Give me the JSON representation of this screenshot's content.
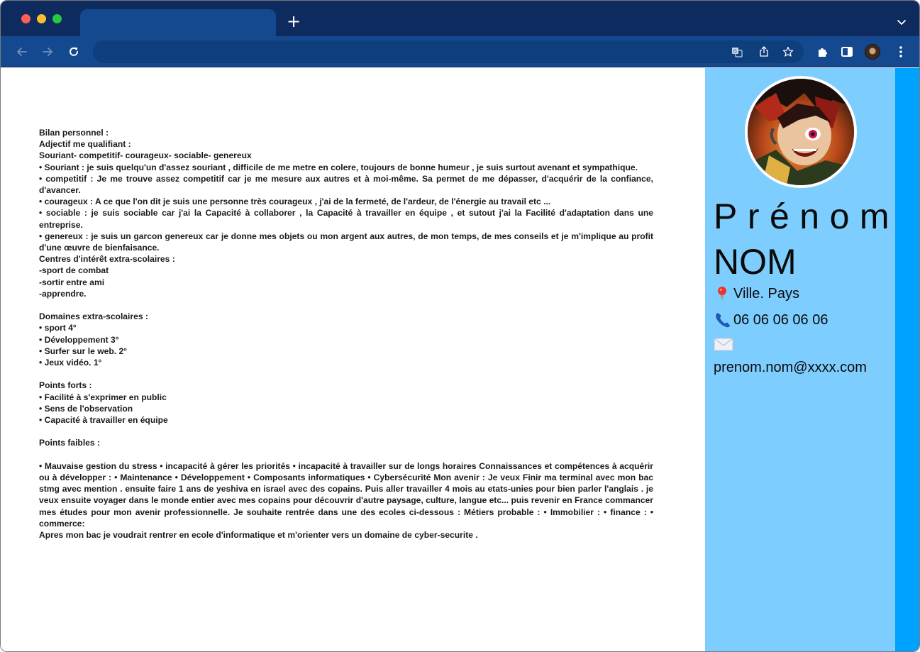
{
  "browser": {
    "new_tab_label": "+",
    "address_value": ""
  },
  "document": {
    "paragraphs": [
      "Bilan personnel :",
      "Adjectif me qualifiant :",
      "Souriant- competitif- courageux- sociable- genereux",
      "• Souriant : je suis quelqu'un d'assez souriant , difficile de me metre en colere, toujours de bonne humeur , je suis surtout avenant et sympathique.",
      "• competitif : Je me trouve assez competitif car je me mesure aux autres et à moi-même. Sa permet de me dépasser, d'acquérir de la confiance, d'avancer.",
      "• courageux : A ce que l'on dit je suis une personne très courageux , j'ai de la fermeté, de l'ardeur, de l'énergie au travail etc ...",
      "• sociable : je suis sociable car j'ai la Capacité à collaborer , la Capacité à travailler en équipe , et sutout j'ai la Facilité d'adaptation dans une entreprise.",
      "• genereux : je suis un garcon genereux car je donne mes objets ou mon argent aux autres, de mon temps, de mes conseils et je m'implique au profit d'une œuvre de bienfaisance.",
      "Centres d'intérêt extra-scolaires :",
      "-sport de combat",
      "-sortir entre ami",
      "-apprendre.",
      "",
      "Domaines extra-scolaires :",
      "• sport 4°",
      "• Développement 3°",
      "• Surfer sur le web. 2°",
      "• Jeux vidéo. 1°",
      "",
      "Points forts :",
      "• Facilité à s'exprimer en public",
      "• Sens de l'observation",
      "• Capacité à travailler en équipe",
      "",
      "Points faibles :",
      "",
      "• Mauvaise gestion du stress • incapacité à gérer les priorités • incapacité à travailler sur de longs horaires Connaissances et compétences à acquérir ou à développer : • Maintenance • Développement • Composants informatiques • Cybersécurité Mon avenir : Je veux Finir ma terminal avec mon bac stmg avec mention . ensuite faire 1 ans de yeshiva en israel avec des copains. Puis aller travailler 4 mois au etats-unies pour bien parler l'anglais . je veux ensuite voyager dans le monde entier avec mes copains pour découvrir d'autre paysage, culture, langue etc... puis revenir en France commancer mes études pour mon avenir professionnelle. Je souhaite rentrée dans une des ecoles ci-dessous : Métiers probable : • Immobilier : • finance : • commerce:",
      "Apres mon bac je voudrait rentrer en ecole d'informatique et m'orienter vers un domaine de cyber-securite ."
    ]
  },
  "sidebar": {
    "first_name": "Prénom",
    "last_name": "NOM",
    "city": "Ville. Pays",
    "phone": "06 06 06 06 06",
    "email": "prenom.nom@xxxx.com",
    "icons": {
      "city": "location-pin-icon",
      "phone": "telephone-icon",
      "email": "envelope-icon"
    }
  },
  "colors": {
    "tabstrip": "#0d2b5e",
    "toolbar": "#14498f",
    "sidebar_bg": "#7ecdff",
    "edge_bar": "#00a2ff"
  }
}
